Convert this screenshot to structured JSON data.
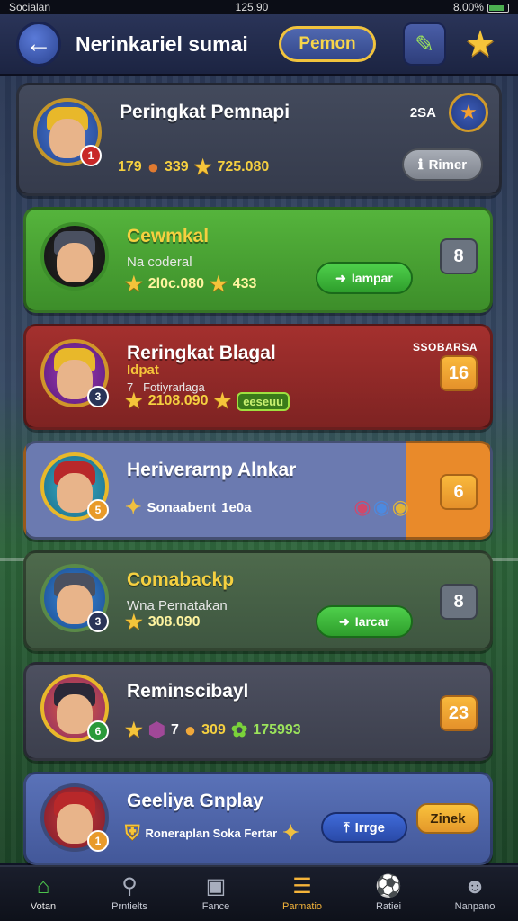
{
  "statusbar": {
    "carrier": "Socialan",
    "time": "125.90",
    "battery": "8.00%"
  },
  "header": {
    "title": "Nerinkariel sumai",
    "pill_label": "Pemon"
  },
  "cards": [
    {
      "name": "Peringkat Pemnapi",
      "corner": "2SA",
      "stats": [
        "179",
        "339",
        "725.080"
      ],
      "button": "Rimer",
      "rank": "1"
    },
    {
      "name": "Cewmkal",
      "sub": "Na coderal",
      "stats": [
        "2l0c.080",
        "433"
      ],
      "button": "Iampar",
      "score": "8"
    },
    {
      "name": "Reringkat Blagal",
      "sub1": "Idpat",
      "sub2a": "7",
      "sub2b": "Fotiyrarlaga",
      "corner": "SSOBARSA",
      "stats": [
        "2108.090"
      ],
      "tag": "eeseuu",
      "score": "16"
    },
    {
      "name": "Heriverarnp Alnkar",
      "sub": "Sonaabent",
      "sub_value": "1e0a",
      "score": "6",
      "rank": "5"
    },
    {
      "name": "Comabackp",
      "sub": "Wna Pernatakan",
      "stats": [
        "308.090"
      ],
      "button": "Iarcar",
      "score": "8",
      "rank": "3"
    },
    {
      "name": "Reminscibayl",
      "stats": [
        "7",
        "309",
        "175993"
      ],
      "score": "23",
      "rank": "6"
    },
    {
      "name": "Geeliya Gnplay",
      "sub": "Roneraplan Soka Fertar",
      "button": "Irrge",
      "button2": "Zinek",
      "rank": "1"
    }
  ],
  "tabs": [
    {
      "label": "Votan",
      "icon": "home-icon"
    },
    {
      "label": "Prntielts",
      "icon": "search-icon"
    },
    {
      "label": "Fance",
      "icon": "camera-icon"
    },
    {
      "label": "Parmatio",
      "icon": "stack-icon"
    },
    {
      "label": "Ratiei",
      "icon": "ball-icon"
    },
    {
      "label": "Nanpano",
      "icon": "profile-icon"
    }
  ]
}
